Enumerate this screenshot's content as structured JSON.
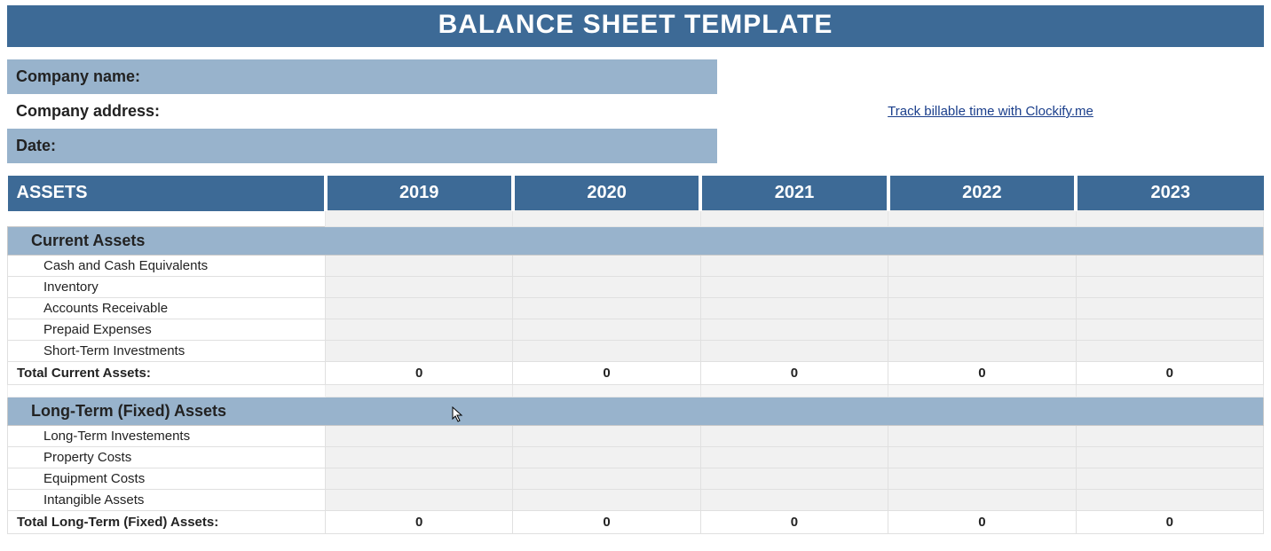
{
  "title": "BALANCE SHEET TEMPLATE",
  "info": {
    "company_name_label": "Company name:",
    "company_address_label": "Company address:",
    "date_label": "Date:"
  },
  "link_text": "Track billable time with Clockify.me",
  "table": {
    "assets_label": "ASSETS",
    "years": [
      "2019",
      "2020",
      "2021",
      "2022",
      "2023"
    ],
    "current_assets": {
      "header": "Current Assets",
      "items": [
        "Cash and Cash Equivalents",
        "Inventory",
        "Accounts Receivable",
        "Prepaid Expenses",
        "Short-Term Investments"
      ],
      "total_label": "Total Current Assets:",
      "totals": [
        "0",
        "0",
        "0",
        "0",
        "0"
      ]
    },
    "fixed_assets": {
      "header": "Long-Term (Fixed) Assets",
      "items": [
        "Long-Term Investements",
        "Property Costs",
        "Equipment Costs",
        "Intangible Assets"
      ],
      "total_label": "Total Long-Term (Fixed) Assets:",
      "totals": [
        "0",
        "0",
        "0",
        "0",
        "0"
      ]
    }
  }
}
